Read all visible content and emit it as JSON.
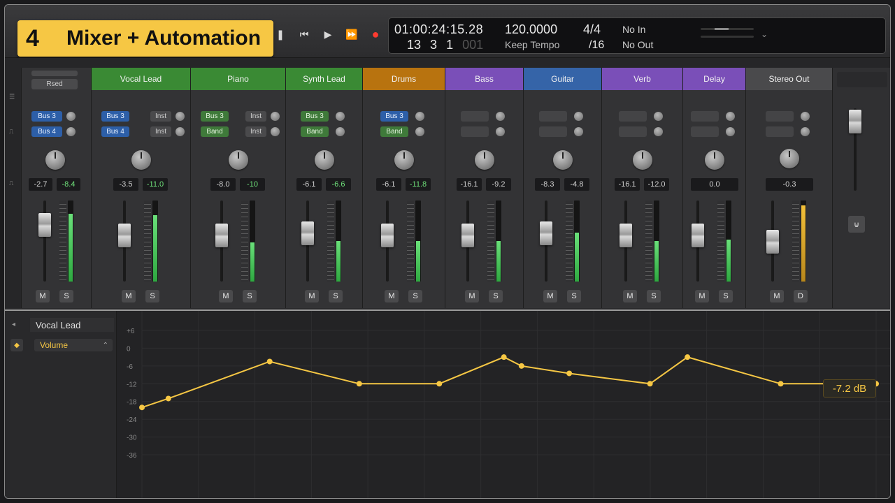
{
  "title": {
    "number": "4",
    "text": "Mixer + Automation"
  },
  "transport": {
    "buttons": [
      "rewind",
      "fast-forward",
      "play",
      "forward",
      "record"
    ]
  },
  "lcd": {
    "timecode": "01:00:24:15.28",
    "bar": "13",
    "beat": "3",
    "division": "1",
    "tick": "001",
    "tempo": "120.0000",
    "tempo_mode": "Keep Tempo",
    "time_signature": "4/4",
    "division_value": "/16",
    "input": "No In",
    "output": "No Out"
  },
  "colors": {
    "green": "#3a8a34",
    "orange": "#b8730f",
    "purple": "#7a4fb8",
    "blue": "#3564a8",
    "grey": "#4a4a4c",
    "automation": "#f6c744"
  },
  "mixer": {
    "input_strip": {
      "sends": [
        "Bus 3",
        "Bus 4"
      ],
      "vals": [
        "-2.7",
        "-8.4"
      ]
    },
    "channels": [
      {
        "name": "Vocal Lead",
        "color": "green",
        "sends": [
          "Bus 3",
          "Bus 4"
        ],
        "sends2": [
          "Inst",
          "Inst"
        ],
        "vals": [
          "-3.5",
          "-11.0"
        ],
        "m": "M",
        "s": "S",
        "fader_level": 0.7,
        "meter_level": 0.82
      },
      {
        "name": "Piano",
        "color": "green",
        "sends": [
          "Bus 3",
          "Band"
        ],
        "sends2": [
          "Inst",
          "Inst"
        ],
        "vals": [
          "-8.0",
          "-10"
        ],
        "m": "M",
        "s": "S",
        "fader_level": 0.7,
        "meter_level": 0.48
      },
      {
        "name": "Synth Lead",
        "color": "green",
        "sends": [
          "Bus 3",
          "Band"
        ],
        "sends2": [],
        "vals": [
          "-6.1",
          "-6.6"
        ],
        "m": "M",
        "s": "S",
        "fader_level": 0.72,
        "meter_level": 0.5
      },
      {
        "name": "Drums",
        "color": "orange",
        "sends": [
          "Bus 3",
          "Band"
        ],
        "sends2": [],
        "vals": [
          "-6.1",
          "-11.8"
        ],
        "m": "M",
        "s": "S",
        "fader_level": 0.7,
        "meter_level": 0.5
      },
      {
        "name": "Bass",
        "color": "purple",
        "sends": [],
        "sends2": [],
        "vals": [
          "-16.1",
          "-9.2"
        ],
        "m": "M",
        "s": "S",
        "fader_level": 0.7,
        "meter_level": 0.5
      },
      {
        "name": "Guitar",
        "color": "blue",
        "sends": [],
        "sends2": [],
        "vals": [
          "-8.3",
          "-4.8"
        ],
        "m": "M",
        "s": "S",
        "fader_level": 0.72,
        "meter_level": 0.6
      },
      {
        "name": "Verb",
        "color": "purple",
        "sends": [],
        "sends2": [],
        "vals": [
          "-16.1",
          "-12.0"
        ],
        "m": "M",
        "s": "S",
        "fader_level": 0.7,
        "meter_level": 0.5
      },
      {
        "name": "Delay",
        "color": "purple",
        "sends": [],
        "sends2": [],
        "vals": [
          "0.0"
        ],
        "m": "M",
        "s": "S",
        "fader_level": 0.7,
        "meter_level": 0.52
      },
      {
        "name": "Stereo Out",
        "color": "grey",
        "sends": [],
        "sends2": [],
        "vals": [
          "-0.3"
        ],
        "m": "M",
        "s": "D",
        "fader_level": 0.62,
        "meter_level": 0.94
      }
    ]
  },
  "automation": {
    "track": "Vocal Lead",
    "parameter": "Volume",
    "current_value": "-7.2 dB",
    "y_ticks": [
      "+6",
      "0",
      "-6",
      "-12",
      "-18",
      "-24",
      "-30",
      "-36"
    ],
    "points": [
      {
        "x": 0.0,
        "db": -20
      },
      {
        "x": 0.036,
        "db": -17
      },
      {
        "x": 0.174,
        "db": -4.5
      },
      {
        "x": 0.296,
        "db": -12
      },
      {
        "x": 0.405,
        "db": -12
      },
      {
        "x": 0.493,
        "db": -3
      },
      {
        "x": 0.517,
        "db": -6
      },
      {
        "x": 0.582,
        "db": -8.5
      },
      {
        "x": 0.692,
        "db": -12
      },
      {
        "x": 0.743,
        "db": -3
      },
      {
        "x": 0.87,
        "db": -12
      },
      {
        "x": 1.0,
        "db": -12
      }
    ]
  }
}
